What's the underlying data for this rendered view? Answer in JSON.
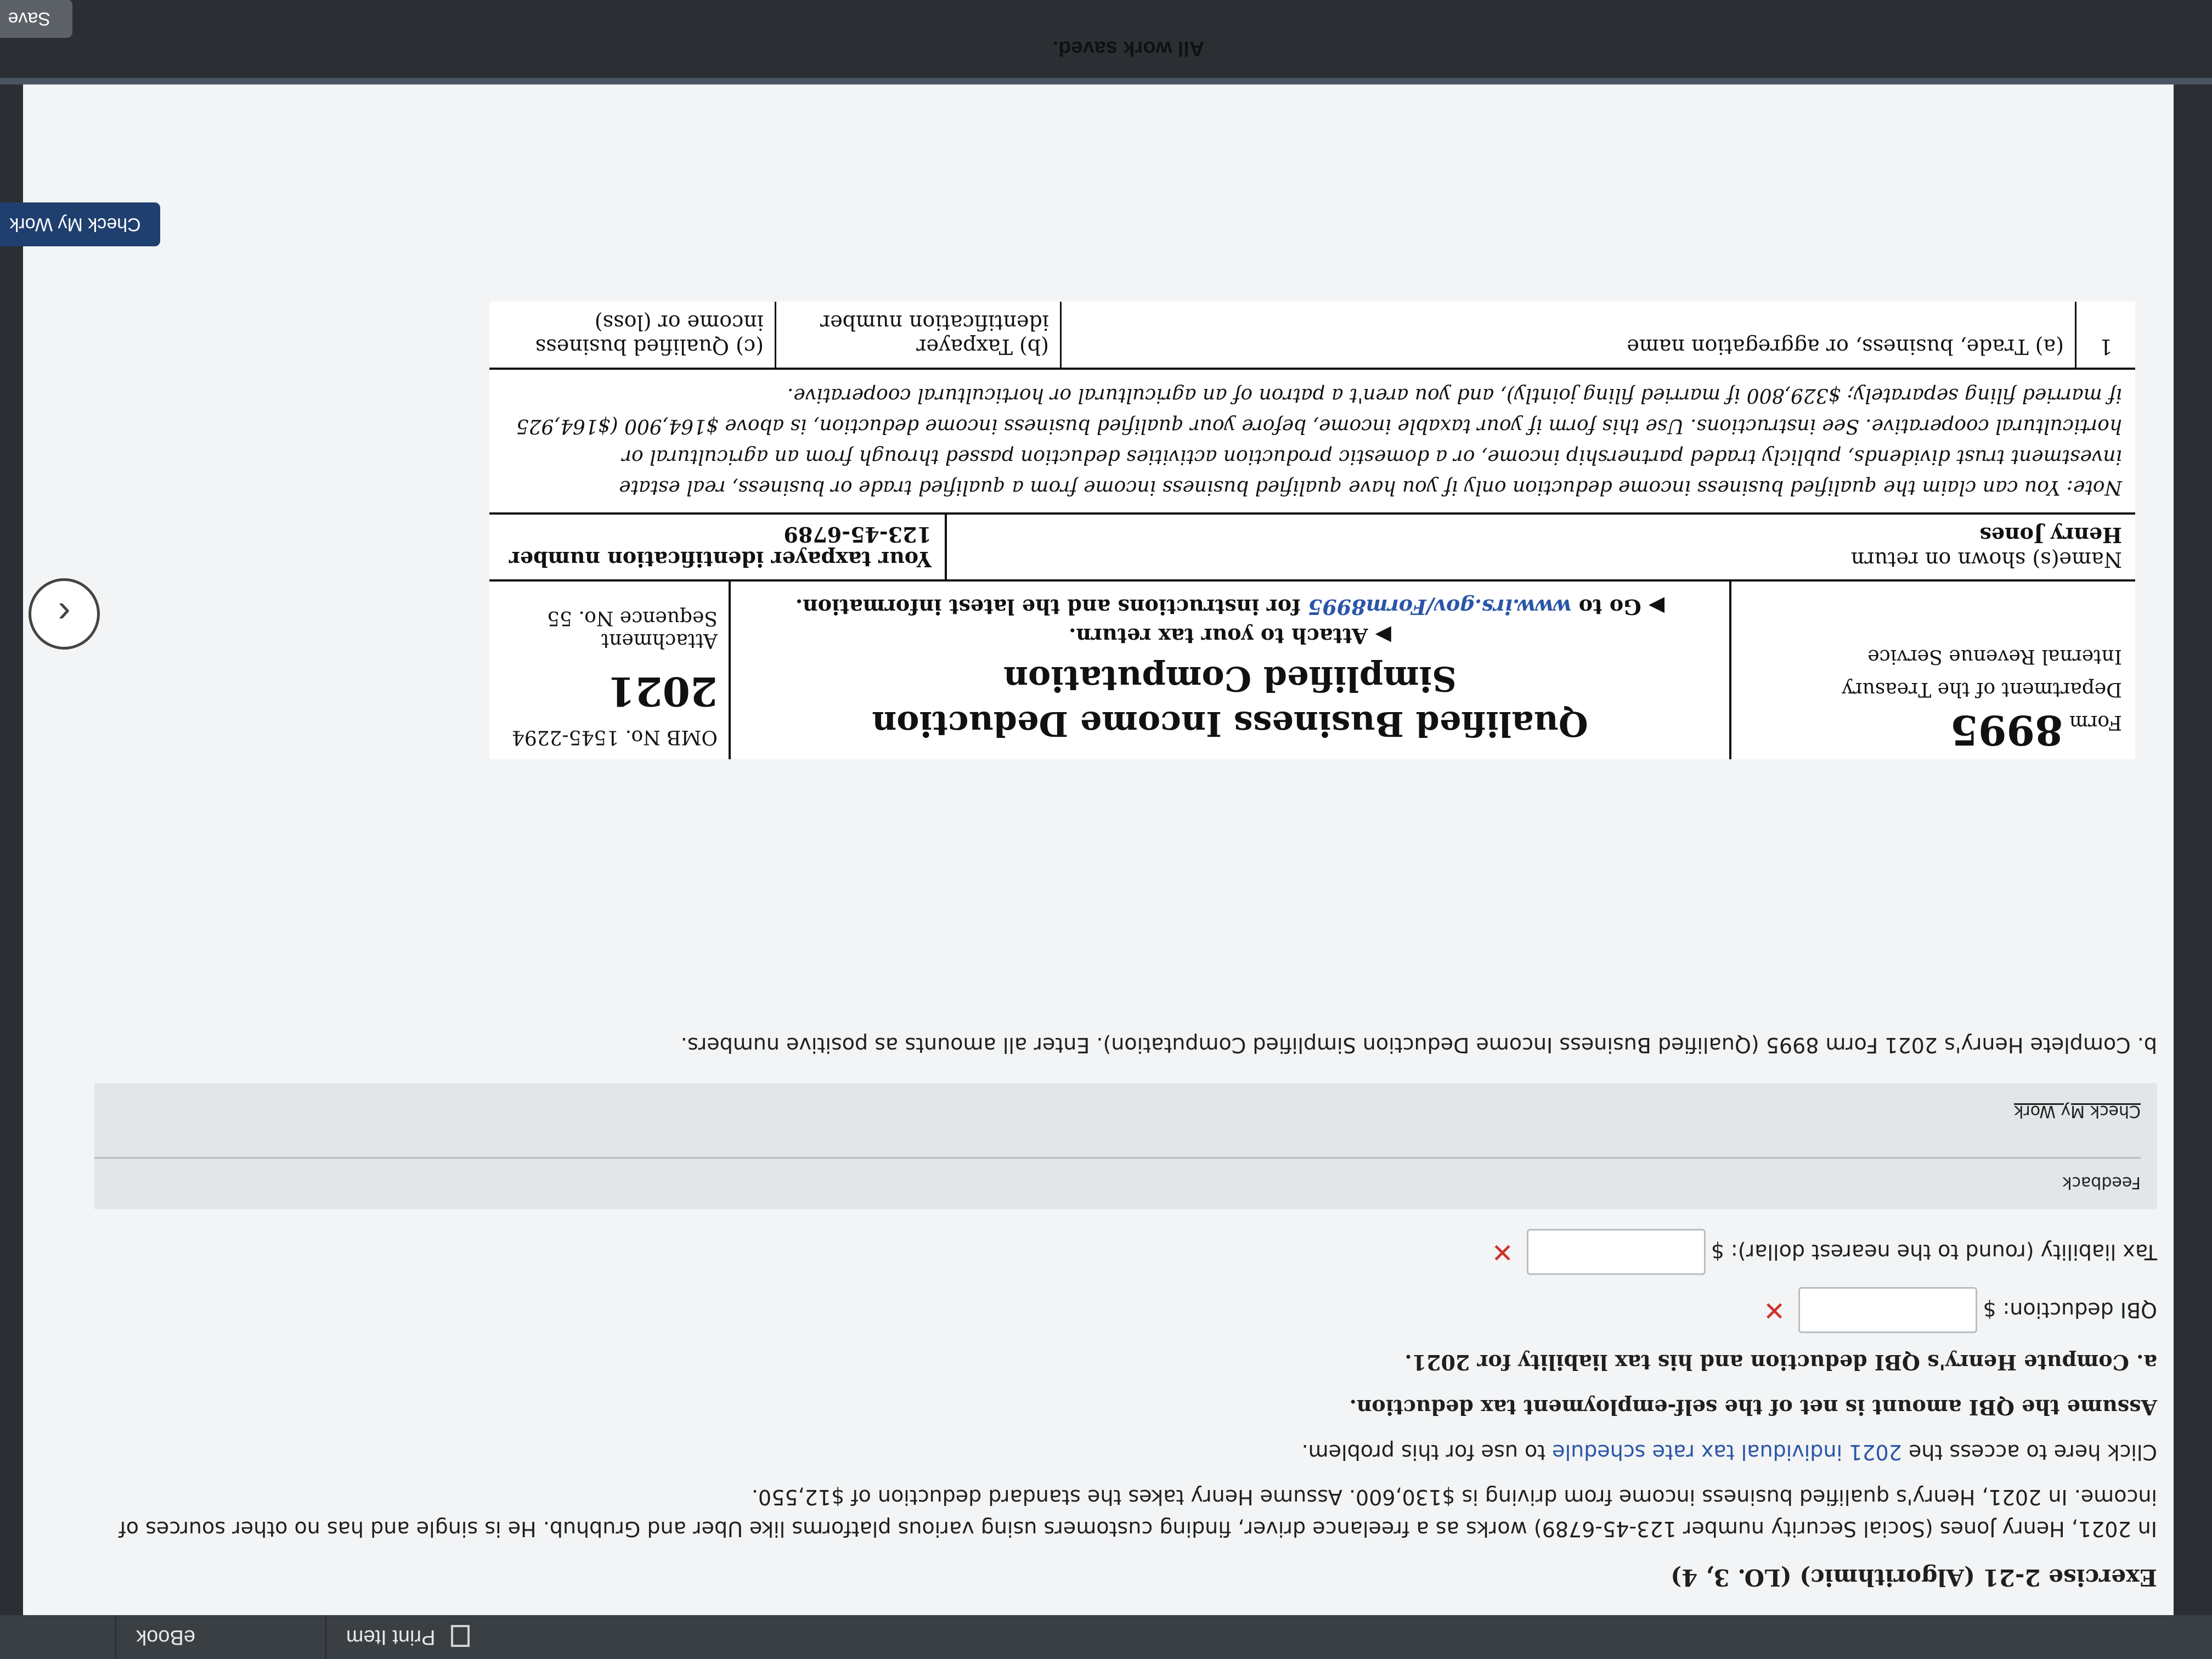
{
  "tabs": {
    "ebook": "eBook",
    "print_item": "Print Item"
  },
  "exercise": {
    "title": "Exercise 2-21 (Algorithmic) (LO. 3, 4)",
    "intro": "In 2021, Henry Jones (Social Security number 123-45-6789) works as a freelance driver, finding customers using various platforms like Uber and Grubhub. He is single and has no other sources of income. In 2021, Henry's qualified business income from driving is $130,600. Assume Henry takes the standard deduction of $12,550.",
    "click_prefix": "Click here to access the ",
    "click_link": "2021 individual tax rate schedule",
    "click_suffix": " to use for this problem.",
    "assume": "Assume the QBI amount is net of the self-employment tax deduction.",
    "part_a": "a.  Compute Henry's QBI deduction and his tax liability for 2021.",
    "qbi_label": "QBI deduction: $",
    "tax_label": "Tax liability (round to the nearest dollar): $",
    "wrong_mark": "✕",
    "feedback_label": "Feedback",
    "feedback_check": "Check My Work",
    "part_b": "b.  Complete Henry's 2021 Form 8995 (Qualified Business Income Deduction Simplified Computation). Enter all amounts as positive numbers."
  },
  "form": {
    "form_label": "Form",
    "form_number": "8995",
    "dept": "Department of the Treasury",
    "irs": "Internal Revenue Service",
    "title_line1": "Qualified Business Income Deduction",
    "title_line2": "Simplified Computation",
    "attach": "▶ Attach to your tax return.",
    "goto_prefix": "▶ Go to ",
    "goto_link": "www.irs.gov/Form8995",
    "goto_suffix": " for instructions and the latest information.",
    "omb": "OMB No. 1545-2294",
    "year": "2021",
    "attachment": "Attachment",
    "sequence": "Sequence No. 55",
    "names_label": "Name(s) shown on return",
    "name_value": "Henry Jones",
    "tin_label": "Your taxpayer identification number",
    "tin_value": "123-45-6789",
    "note": "Note: You can claim the qualified business income deduction only if you have qualified business income from a qualified trade or business, real estate investment trust dividends, publicly traded partnership income, or a domestic production activities deduction passed through from an agricultural or horticultural cooperative. See instructions. Use this form if your taxable income, before your qualified business income deduction, is above $164,900 ($164,925 if married filing separately; $329,800 if married filing jointly), and you aren't a patron of an agricultural or horticultural cooperative.",
    "line_num": "1",
    "col_a": "(a) Trade, business, or aggregation name",
    "col_b": "(b) Taxpayer identification number",
    "col_c": "(c) Qualified business income or (loss)"
  },
  "footer": {
    "check_my_work": "Check My Work",
    "all_saved": "All work saved.",
    "save_button": "Save a"
  }
}
